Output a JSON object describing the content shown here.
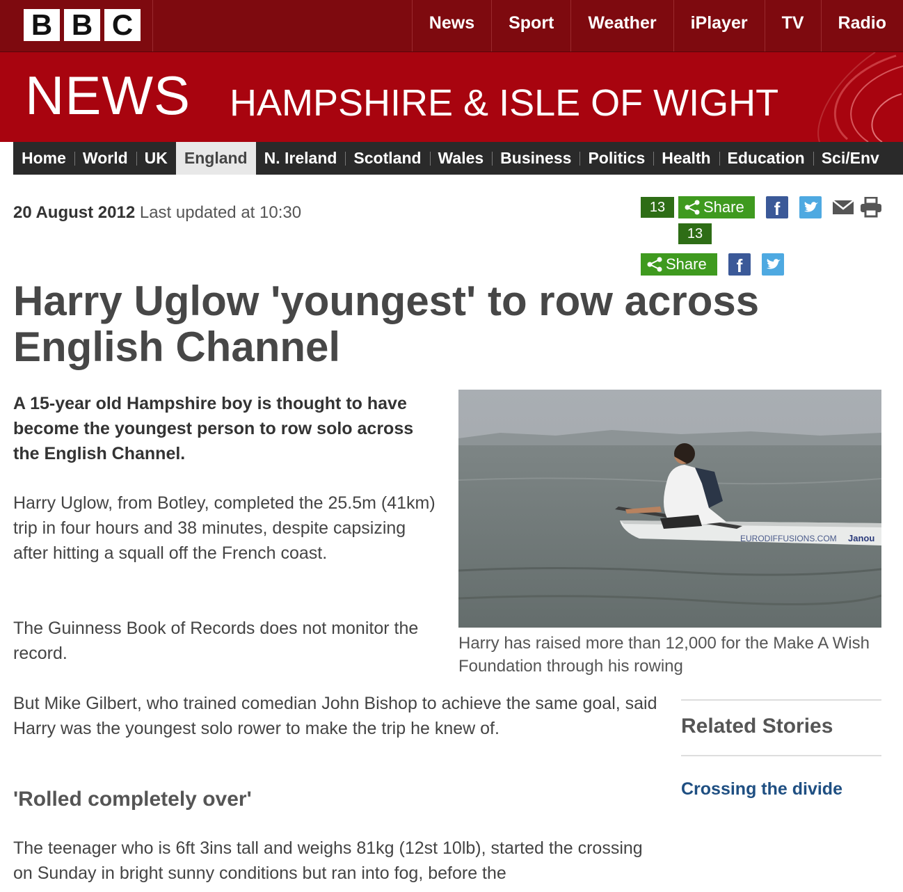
{
  "header": {
    "logo": [
      "B",
      "B",
      "C"
    ],
    "topnav": [
      "News",
      "Sport",
      "Weather",
      "iPlayer",
      "TV",
      "Radio"
    ]
  },
  "banner": {
    "news_word": "NEWS",
    "region": "HAMPSHIRE & ISLE OF WIGHT"
  },
  "section_nav": [
    "Home",
    "World",
    "UK",
    "England",
    "N. Ireland",
    "Scotland",
    "Wales",
    "Business",
    "Politics",
    "Health",
    "Education",
    "Sci/Env"
  ],
  "section_nav_active": "England",
  "dateline": {
    "date": "20 August 2012",
    "updated": "Last updated at 10:30"
  },
  "share": {
    "count_1": "13",
    "count_2": "13",
    "label_1": "Share",
    "label_2": "Share",
    "facebook_letter": "f",
    "colors": {
      "count": "#2e6d16",
      "button": "#3f9a1f",
      "facebook": "#3b5998",
      "twitter": "#4ea9e1"
    }
  },
  "article": {
    "headline": "Harry Uglow 'youngest' to row across English Channel",
    "intro": "A 15-year old Hampshire boy is thought to have become the youngest person to row solo across the English Channel.",
    "p1": "Harry Uglow, from Botley, completed the 25.5m (41km) trip in four hours and 38 minutes, despite capsizing after hitting a squall off the French coast.",
    "p2": "The Guinness Book of Records does not monitor the record.",
    "p3": "But Mike Gilbert, who trained comedian John Bishop to achieve the same goal, said Harry was the youngest solo rower to make the trip he knew of.",
    "subhead": "'Rolled completely over'",
    "p4": "The teenager who is 6ft 3ins tall and weighs 81kg (12st 10lb), started the crossing on Sunday in bright sunny conditions but ran into fog, before the"
  },
  "photo": {
    "boat_text_1": "EURODIFFUSIONS.COM",
    "boat_text_2": "Janou",
    "caption": "Harry has raised more than 12,000 for the Make A Wish Foundation through his rowing"
  },
  "related": {
    "title": "Related Stories",
    "links": [
      "Crossing the divide"
    ]
  }
}
